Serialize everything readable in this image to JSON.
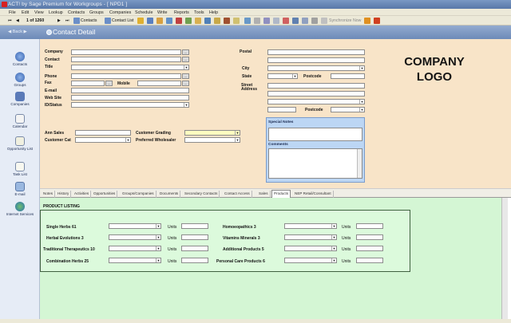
{
  "window": {
    "title": "ACT! by Sage Premium for Workgroups - [ NPD1 ]"
  },
  "menu": [
    "File",
    "Edit",
    "View",
    "Lookup",
    "Contacts",
    "Groups",
    "Companies",
    "Schedule",
    "Write",
    "Reports",
    "Tools",
    "Help"
  ],
  "toolbar": {
    "record_position": "1 of 1260",
    "contacts_label": "Contacts",
    "contact_list_label": "Contact List",
    "sync_label": "Synchronize Now"
  },
  "header": {
    "back_label": "Back",
    "title": "Contact Detail"
  },
  "nav": [
    "Contacts",
    "Groups",
    "Companies",
    "Calendar",
    "Opportunity List",
    "Task List",
    "E-mail",
    "Internet Services"
  ],
  "form": {
    "left_labels": [
      "Company",
      "Contact",
      "Title",
      "Phone",
      "Fax",
      "E-mail",
      "Web Site",
      "ID/Status"
    ],
    "mobile_label": "Mobile",
    "right_labels": {
      "postal": "Postal",
      "city": "City",
      "state": "State",
      "postcode": "Postcode",
      "street": "Street Address",
      "postcode2": "Postcode"
    },
    "ann_sales": "Ann Sales",
    "customer_cat": "Customer Cat",
    "customer_grading": "Customer Grading",
    "preferred_wholesaler": "Preferred Wholesaler",
    "special_notes": "Special Notes",
    "comments": "Comments"
  },
  "logo": {
    "line1": "COMPANY",
    "line2": "LOGO"
  },
  "tabs": [
    "Notes",
    "History",
    "Activities",
    "Opportunities",
    "Groups/Companies",
    "Documents",
    "Secondary Contacts",
    "Contact Access",
    "Sales",
    "Products",
    "NEP Retail/Consultant"
  ],
  "active_tab": "Products",
  "products": {
    "title": "PRODUCT LISTING",
    "units_label": "Units",
    "left": [
      "Single Herbs 61",
      "Herbal Evolutions 3",
      "Traditional Therapeutics 10",
      "Combination Herbs 25"
    ],
    "right": [
      "Homoeopathics 3",
      "Vitamins Minerals 3",
      "Additional Products 5",
      "Personal Care Products 6"
    ]
  },
  "colors": {
    "form_bg": "#f8e4c8",
    "products_bg": "#d4f6d4",
    "notes_bg": "#bcd6f4",
    "header_bg": "#6d8ab8"
  }
}
